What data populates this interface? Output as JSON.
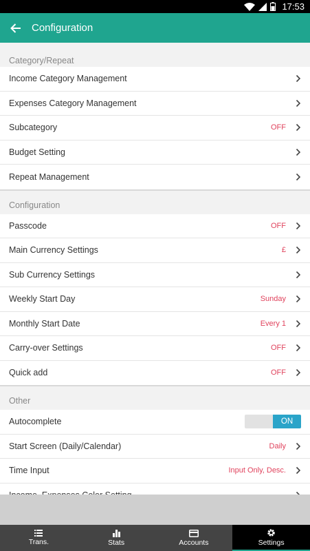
{
  "status_bar": {
    "time": "17:53"
  },
  "app_bar": {
    "title": "Configuration"
  },
  "sections": [
    {
      "header": "Category/Repeat",
      "rows": [
        {
          "label": "Income Category Management",
          "value": ""
        },
        {
          "label": "Expenses Category Management",
          "value": ""
        },
        {
          "label": "Subcategory",
          "value": "OFF"
        },
        {
          "label": "Budget Setting",
          "value": ""
        },
        {
          "label": "Repeat Management",
          "value": ""
        }
      ]
    },
    {
      "header": "Configuration",
      "rows": [
        {
          "label": "Passcode",
          "value": "OFF"
        },
        {
          "label": "Main Currency Settings",
          "value": "£"
        },
        {
          "label": "Sub Currency Settings",
          "value": ""
        },
        {
          "label": "Weekly Start Day",
          "value": "Sunday"
        },
        {
          "label": "Monthly Start Date",
          "value": "Every 1"
        },
        {
          "label": "Carry-over Settings",
          "value": "OFF"
        },
        {
          "label": "Quick add",
          "value": "OFF"
        }
      ]
    },
    {
      "header": "Other",
      "rows": [
        {
          "label": "Autocomplete",
          "toggle": "ON"
        },
        {
          "label": "Start Screen (Daily/Calendar)",
          "value": "Daily"
        },
        {
          "label": "Time Input",
          "value": "Input Only, Desc."
        },
        {
          "label": "Income, Expenses Color Setting",
          "value": ""
        }
      ]
    }
  ],
  "bottom_nav": [
    {
      "label": "Trans.",
      "icon": "list-icon",
      "active": false
    },
    {
      "label": "Stats",
      "icon": "bar-chart-icon",
      "active": false
    },
    {
      "label": "Accounts",
      "icon": "wallet-icon",
      "active": false
    },
    {
      "label": "Settings",
      "icon": "gear-icon",
      "active": true
    }
  ],
  "colors": {
    "accent": "#1fa58f",
    "value_text": "#e0425c",
    "toggle_on": "#2aa4c9"
  }
}
